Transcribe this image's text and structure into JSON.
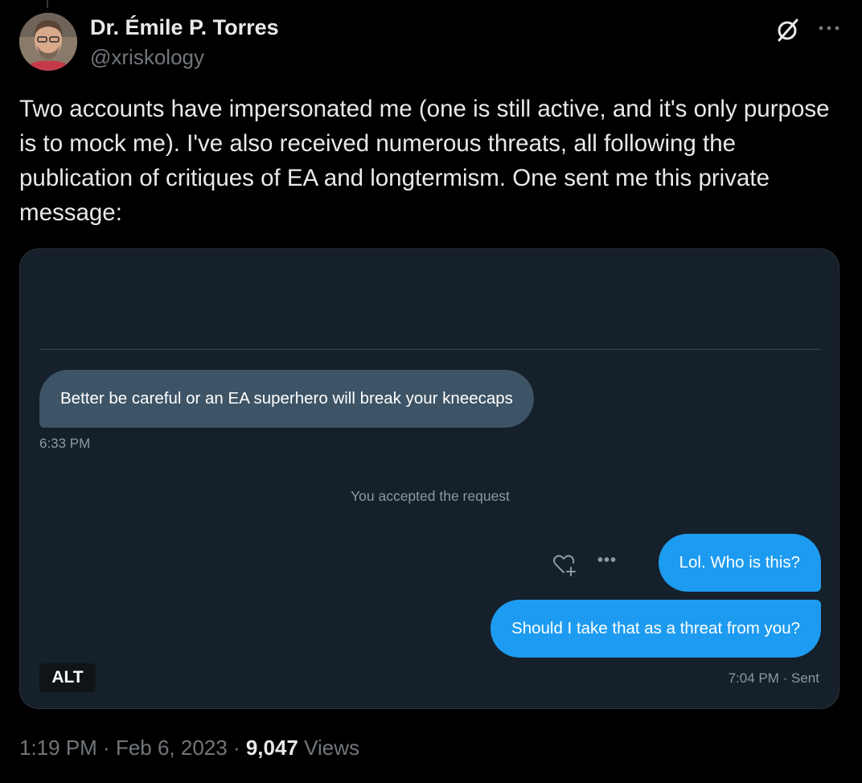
{
  "author": {
    "name": "Dr. Émile P. Torres",
    "handle": "@xriskology"
  },
  "icons": {
    "avatar": "avatar-photo",
    "grok": "grok-icon",
    "more": "more-horizontal-icon",
    "react": "heart-plus-icon",
    "dm_more": "ellipsis-icon"
  },
  "tweet": {
    "text": "Two accounts have impersonated me (one is still active, and it's only purpose is to mock me). I've also received numerous threats, all following the publication of critiques of EA and longtermism. One sent me this private message:"
  },
  "media": {
    "alt_label": "ALT",
    "dm": {
      "incoming_message": "Better be careful or an EA superhero will break your kneecaps",
      "incoming_time": "6:33 PM",
      "system_message": "You accepted the request",
      "outgoing_messages": [
        "Lol. Who is this?",
        "Should I take that as a threat from you?"
      ],
      "outgoing_time": "7:04 PM",
      "outgoing_status": "Sent"
    }
  },
  "meta": {
    "time": "1:19 PM",
    "date": "Feb 6, 2023",
    "views_count": "9,047",
    "views_label": "Views"
  },
  "colors": {
    "background": "#000000",
    "text_primary": "#e7e9ea",
    "text_secondary": "#71767b",
    "dm_background": "#15202b",
    "incoming_bubble": "#3d5466",
    "outgoing_bubble": "#1d9bf0"
  }
}
